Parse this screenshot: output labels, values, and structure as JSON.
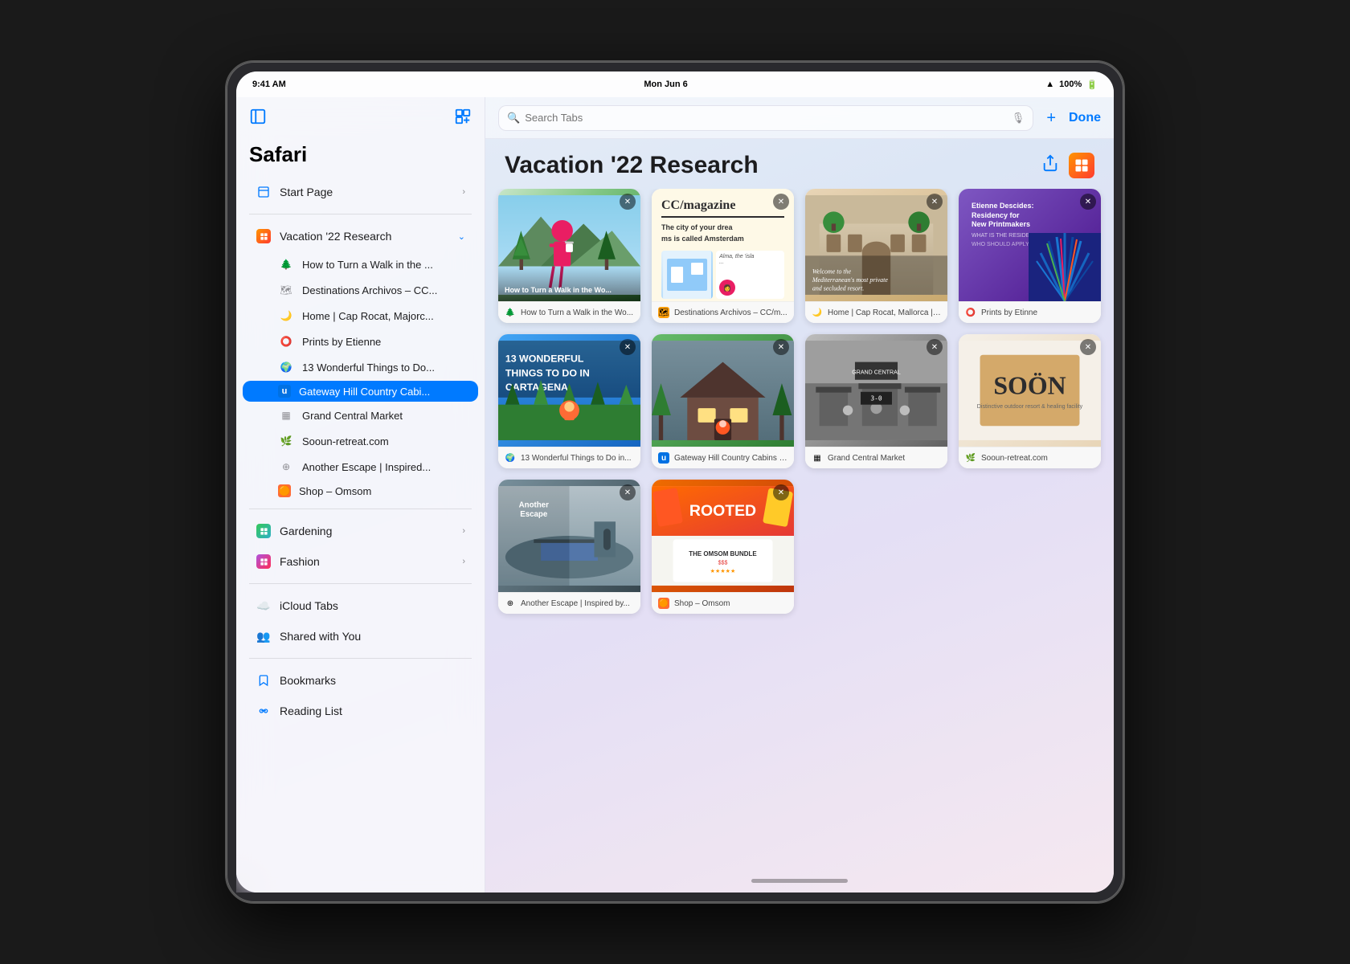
{
  "device": {
    "time": "9:41 AM",
    "date": "Mon Jun 6",
    "battery": "100%",
    "battery_full": true
  },
  "toolbar": {
    "search_placeholder": "Search Tabs",
    "done_label": "Done",
    "add_label": "+"
  },
  "sidebar": {
    "title": "Safari",
    "start_page": "Start Page",
    "groups": [
      {
        "name": "Vacation '22 Research",
        "color": "vacation",
        "expanded": true,
        "items": [
          {
            "label": "How to Turn a Walk in the ...",
            "icon": "🌲"
          },
          {
            "label": "Destinations Archivos – CC...",
            "icon": "🗺"
          },
          {
            "label": "Home | Cap Rocat, Majorc...",
            "icon": "🌙"
          },
          {
            "label": "Prints by Etienne",
            "icon": "⭕"
          },
          {
            "label": "13 Wonderful Things to Do...",
            "icon": "🌍"
          },
          {
            "label": "Gateway Hill Country Cabi...",
            "icon": "u",
            "active": true
          },
          {
            "label": "Grand Central Market",
            "icon": "▦"
          },
          {
            "label": "Sooun-retreat.com",
            "icon": "🌿"
          },
          {
            "label": "Another Escape | Inspired...",
            "icon": "⊕"
          },
          {
            "label": "Shop – Omsom",
            "icon": "🟠"
          }
        ]
      },
      {
        "name": "Gardening",
        "color": "gardening",
        "expanded": false
      },
      {
        "name": "Fashion",
        "color": "fashion",
        "expanded": false
      }
    ],
    "icloud_tabs": "iCloud Tabs",
    "shared_with_you": "Shared with You",
    "bookmarks": "Bookmarks",
    "reading_list": "Reading List"
  },
  "tab_group": {
    "title": "Vacation '22 Research",
    "tabs": [
      {
        "id": "walk",
        "title": "How to Turn a Walk in the Wo...",
        "thumb_type": "walk",
        "thumb_text": "How to Turn a Walk in the Wo...",
        "favicon_char": "🌲",
        "favicon_color": "#34c759"
      },
      {
        "id": "cc",
        "title": "Destinations Archivos – CC/m...",
        "thumb_type": "cc",
        "thumb_text": "Destinations Archivos – CC/m...",
        "favicon_char": "🗺",
        "favicon_color": "#ff9f0a"
      },
      {
        "id": "resort",
        "title": "Home | Cap Rocat, Mallorca | ...",
        "thumb_type": "resort",
        "thumb_text": "Home | Cap Rocat, Mallorca | ...",
        "favicon_char": "🌙",
        "favicon_color": "#5ac8fa"
      },
      {
        "id": "etienne",
        "title": "Prints by Etinne",
        "thumb_type": "etienne",
        "thumb_text": "Prints by Etinne",
        "favicon_char": "⭕",
        "favicon_color": "#af52de"
      },
      {
        "id": "13things",
        "title": "13 Wonderful Things to Do in...",
        "thumb_type": "13things",
        "thumb_text": "13 Wonderful Things to Do in...",
        "favicon_char": "🌍",
        "favicon_color": "#007aff"
      },
      {
        "id": "gateway",
        "title": "Gateway Hill Country Cabins | ...",
        "thumb_type": "gateway",
        "thumb_text": "Gateway Hill Country Cabins | ...",
        "favicon_char": "u",
        "favicon_color": "#0071e3"
      },
      {
        "id": "gcm",
        "title": "Grand Central Market",
        "thumb_type": "gcm",
        "thumb_text": "Grand Central Market",
        "favicon_char": "▦",
        "favicon_color": "#636366"
      },
      {
        "id": "sooun",
        "title": "Sooun-retreat.com",
        "thumb_type": "sooun",
        "thumb_text": "Sooun-retreat.com",
        "favicon_char": "🌿",
        "favicon_color": "#34c759"
      },
      {
        "id": "escape",
        "title": "Another Escape | Inspired by...",
        "thumb_type": "escape",
        "thumb_text": "Another Escape | Inspired by...",
        "favicon_char": "⊕",
        "favicon_color": "#636366"
      },
      {
        "id": "omsom",
        "title": "Shop – Omsom",
        "thumb_type": "omsom",
        "thumb_text": "Shop – Omsom",
        "favicon_char": "🟠",
        "favicon_color": "#ff6b35"
      }
    ]
  },
  "colors": {
    "accent": "#007aff",
    "active_bg": "#007aff",
    "sidebar_bg": "rgba(248,248,252,0.85)"
  }
}
